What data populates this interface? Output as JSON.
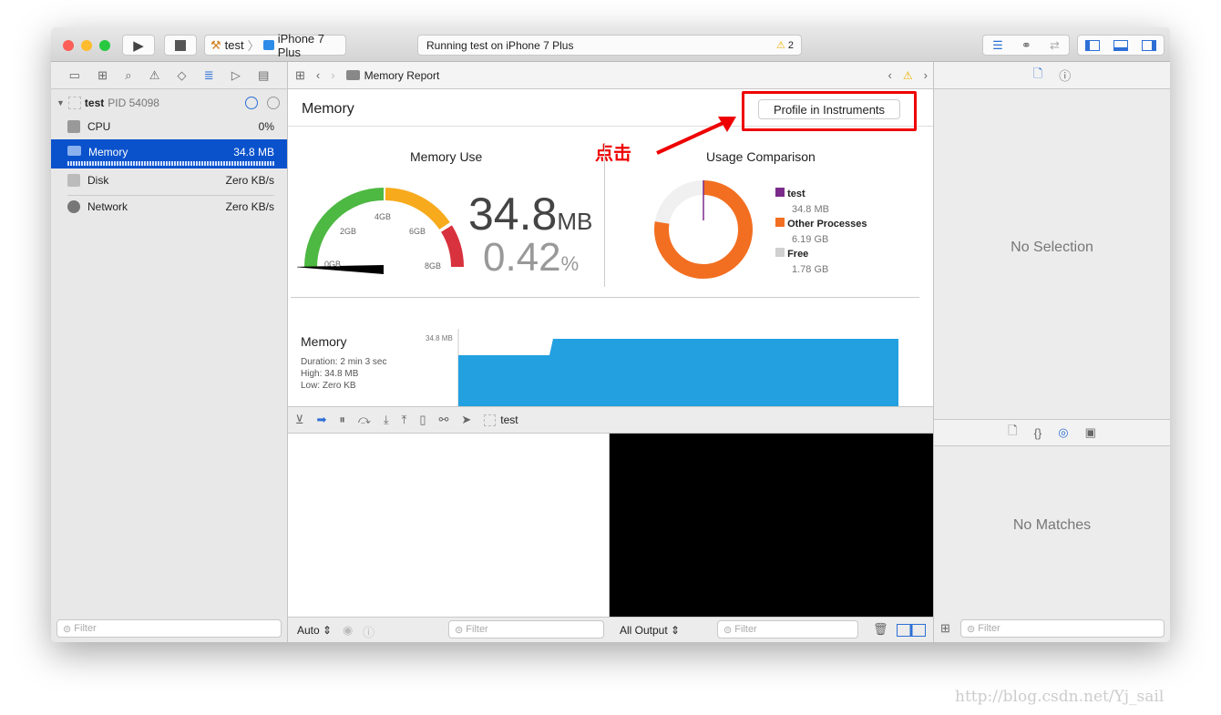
{
  "toolbar": {
    "scheme": "test",
    "device": "iPhone 7 Plus",
    "status": "Running test on iPhone 7 Plus",
    "warning_count": "2"
  },
  "navigator": {
    "process_name": "test",
    "process_pid": "PID 54098",
    "items": [
      {
        "label": "CPU",
        "value": "0%"
      },
      {
        "label": "Memory",
        "value": "34.8 MB"
      },
      {
        "label": "Disk",
        "value": "Zero KB/s"
      },
      {
        "label": "Network",
        "value": "Zero KB/s"
      }
    ],
    "filter_placeholder": "Filter"
  },
  "jumpbar": {
    "title": "Memory Report"
  },
  "report": {
    "title": "Memory",
    "profile_button": "Profile in Instruments",
    "annotation": "点击",
    "memory_use": {
      "title": "Memory Use",
      "value": "34.8",
      "unit": "MB",
      "percent": "0.42",
      "percent_unit": "%",
      "gauge_labels": [
        "0GB",
        "2GB",
        "4GB",
        "6GB",
        "8GB"
      ],
      "gauge_fraction": 0.0042
    },
    "usage": {
      "title": "Usage Comparison",
      "legend": [
        {
          "name": "test",
          "value": "34.8 MB",
          "color": "#7b2a8c"
        },
        {
          "name": "Other Processes",
          "value": "6.19 GB",
          "color": "#f26f21"
        },
        {
          "name": "Free",
          "value": "1.78 GB",
          "color": "#d0d0d0"
        }
      ]
    },
    "timeline": {
      "title": "Memory",
      "duration": "Duration: 2 min 3 sec",
      "high": "High: 34.8 MB",
      "low": "Low: Zero KB",
      "y_label": "34.8 MB",
      "color": "#22a0e0"
    }
  },
  "debugbar": {
    "process": "test"
  },
  "console": {
    "auto_label": "Auto",
    "output_label": "All Output",
    "filter_placeholder": "Filter"
  },
  "inspector": {
    "no_selection": "No Selection",
    "no_matches": "No Matches",
    "filter_placeholder": "Filter"
  },
  "watermark": "http://blog.csdn.net/Yj_sail"
}
